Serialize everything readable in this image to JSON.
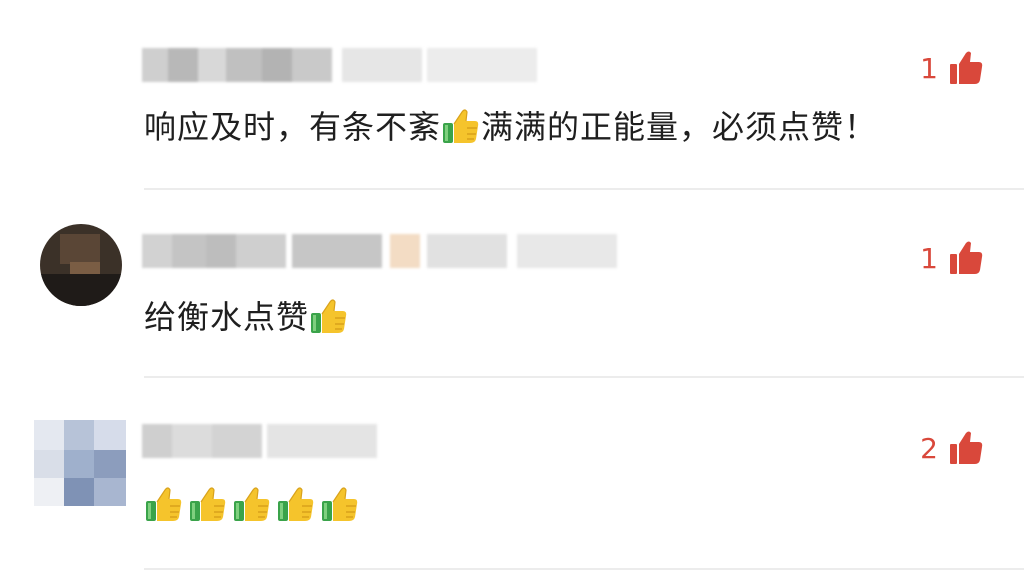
{
  "comments": [
    {
      "text": "响应及时，有条不紊",
      "text_after": "满满的正能量，必须点赞！",
      "likes": "1",
      "username_blurred": true
    },
    {
      "text": "给衡水点赞",
      "likes": "1",
      "username_blurred": true
    },
    {
      "likes": "2",
      "username_blurred": true,
      "thumbs_count": 5
    }
  ],
  "colors": {
    "like_accent": "#d9483b",
    "divider": "#ececec",
    "text": "#1f1f1f"
  },
  "icons": {
    "like": "thumbs-up-icon",
    "emoji": "thumbs-up-emoji"
  }
}
